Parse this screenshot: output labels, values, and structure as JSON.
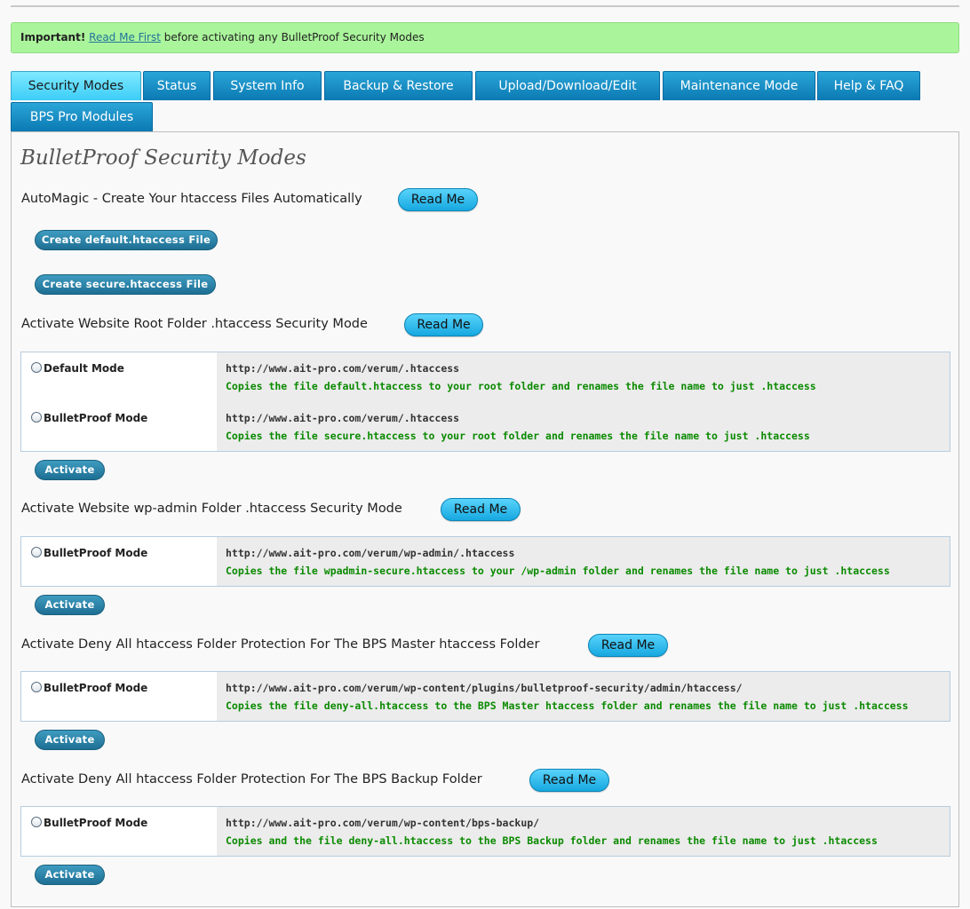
{
  "notice": {
    "label": "Important!",
    "link": "Read Me First",
    "text": " before activating any BulletProof Security Modes"
  },
  "tabs": [
    {
      "label": "Security Modes",
      "active": true
    },
    {
      "label": "Status"
    },
    {
      "label": "System Info"
    },
    {
      "label": "Backup & Restore"
    },
    {
      "label": "Upload/Download/Edit"
    },
    {
      "label": "Maintenance Mode"
    },
    {
      "label": "Help & FAQ"
    },
    {
      "label": "BPS Pro Modules"
    }
  ],
  "page_title": "BulletProof Security Modes",
  "readme_label": "Read Me",
  "activate_label": "Activate",
  "automagic": {
    "title": "AutoMagic - Create Your htaccess Files Automatically",
    "btn_default": "Create default.htaccess File",
    "btn_secure": "Create secure.htaccess File"
  },
  "root": {
    "title": "Activate Website Root Folder .htaccess Security Mode",
    "options": [
      {
        "label": "Default Mode",
        "url": "http://www.ait-pro.com/verum/.htaccess",
        "desc": "Copies the file default.htaccess to your root folder and renames the file name to just .htaccess"
      },
      {
        "label": "BulletProof Mode",
        "url": "http://www.ait-pro.com/verum/.htaccess",
        "desc": "Copies the file secure.htaccess to your root folder and renames the file name to just .htaccess"
      }
    ]
  },
  "wpadmin": {
    "title": "Activate Website wp-admin Folder .htaccess Security Mode",
    "option": {
      "label": "BulletProof Mode",
      "url": "http://www.ait-pro.com/verum/wp-admin/.htaccess",
      "desc": "Copies the file wpadmin-secure.htaccess to your /wp-admin folder and renames the file name to just .htaccess"
    }
  },
  "master": {
    "title": "Activate Deny All htaccess Folder Protection For The BPS Master htaccess Folder",
    "option": {
      "label": "BulletProof Mode",
      "url": "http://www.ait-pro.com/verum/wp-content/plugins/bulletproof-security/admin/htaccess/",
      "desc": "Copies the file deny-all.htaccess to the BPS Master htaccess folder and renames the file name to just .htaccess"
    }
  },
  "backup": {
    "title": "Activate Deny All htaccess Folder Protection For The BPS Backup Folder",
    "option": {
      "label": "BulletProof Mode",
      "url": "http://www.ait-pro.com/verum/wp-content/bps-backup/",
      "desc": "Copies and the file deny-all.htaccess to the BPS Backup folder and renames the file name to just .htaccess"
    }
  }
}
